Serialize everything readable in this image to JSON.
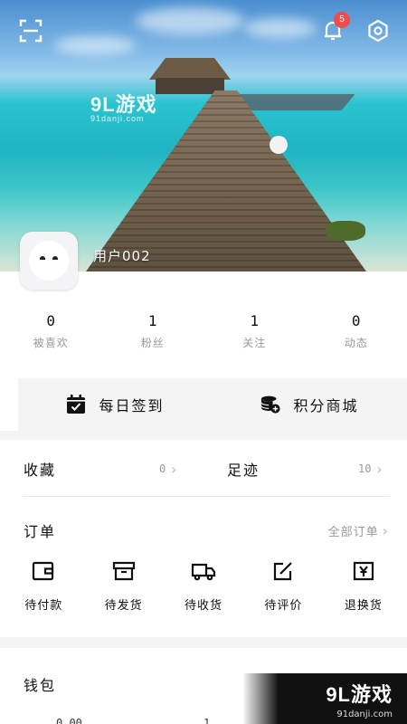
{
  "header": {
    "notification_badge": "5",
    "username": "用户002",
    "watermark": {
      "logo": "9L游戏",
      "domain": "91danji.com"
    }
  },
  "stats": [
    {
      "value": "0",
      "label": "被喜欢"
    },
    {
      "value": "1",
      "label": "粉丝"
    },
    {
      "value": "1",
      "label": "关注"
    },
    {
      "value": "0",
      "label": "动态"
    }
  ],
  "quick_actions": {
    "checkin": "每日签到",
    "points_mall": "积分商城"
  },
  "favorites": {
    "label": "收藏",
    "count": "0"
  },
  "footprint": {
    "label": "足迹",
    "count": "10"
  },
  "orders": {
    "title": "订单",
    "all": "全部订单",
    "items": [
      {
        "label": "待付款",
        "icon": "wallet-icon"
      },
      {
        "label": "待发货",
        "icon": "box-icon"
      },
      {
        "label": "待收货",
        "icon": "truck-icon"
      },
      {
        "label": "待评价",
        "icon": "edit-icon"
      },
      {
        "label": "退换货",
        "icon": "yen-icon"
      }
    ]
  },
  "wallet": {
    "title": "钱包",
    "peek_left": "0.00",
    "peek_right": "1"
  },
  "brand_watermark": {
    "logo": "9L游戏",
    "domain": "91danji.com"
  },
  "colors": {
    "badge": "#ef4c4c",
    "accent_bg": "#f4f4f4"
  }
}
